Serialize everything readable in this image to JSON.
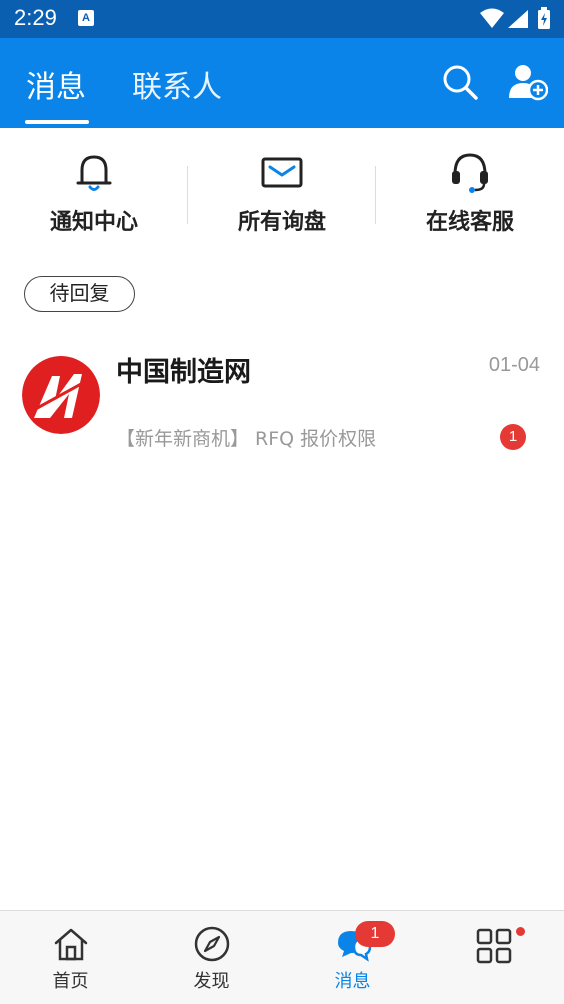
{
  "status_bar": {
    "time": "2:29",
    "notification_icon": "A"
  },
  "header": {
    "tabs": [
      {
        "label": "消息",
        "active": true
      },
      {
        "label": "联系人",
        "active": false
      }
    ],
    "icons": [
      "search-icon",
      "add-user-icon"
    ],
    "color": "#0a84e8"
  },
  "quick_actions": [
    {
      "label": "通知中心",
      "icon": "bell-icon"
    },
    {
      "label": "所有询盘",
      "icon": "envelope-icon"
    },
    {
      "label": "在线客服",
      "icon": "headset-icon"
    }
  ],
  "filter": {
    "label": "待回复"
  },
  "messages": [
    {
      "name": "中国制造网",
      "date": "01-04",
      "preview": "【新年新商机】 RFQ 报价权限",
      "unread": "1",
      "avatar": "made-in-china-logo"
    }
  ],
  "bottom_nav": {
    "items": [
      {
        "label": "首页",
        "icon": "home-icon"
      },
      {
        "label": "发现",
        "icon": "compass-icon"
      },
      {
        "label": "消息",
        "icon": "chat-icon",
        "badge": "1",
        "active": true
      },
      {
        "label": "",
        "icon": "grid-apps-icon",
        "dot": true
      }
    ]
  }
}
